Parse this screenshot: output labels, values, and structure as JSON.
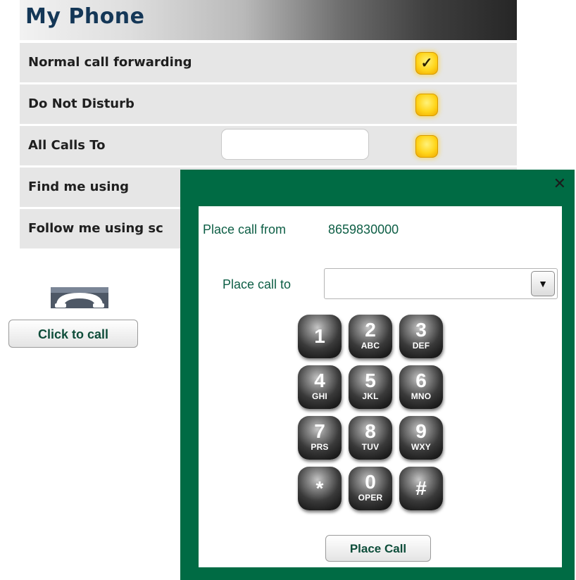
{
  "header": {
    "title": "My Phone"
  },
  "rows": [
    {
      "label": "Normal call forwarding",
      "checked": true
    },
    {
      "label": "Do Not Disturb",
      "checked": false
    },
    {
      "label": "All Calls To",
      "checked": false,
      "input_value": ""
    },
    {
      "label": "Find me using"
    },
    {
      "label": "Follow me using sc"
    }
  ],
  "checkmark": "✓",
  "phone": {
    "icon": "phone-handset-icon",
    "click_to_call_label": "Click to call"
  },
  "dialog": {
    "close_label": "✕",
    "place_call_from_label": "Place call from",
    "place_call_from_value": "8659830000",
    "place_call_to_label": "Place call to",
    "place_call_to_value": "",
    "dropdown_arrow": "▼",
    "keypad": [
      {
        "digit": "1",
        "letters": ""
      },
      {
        "digit": "2",
        "letters": "ABC"
      },
      {
        "digit": "3",
        "letters": "DEF"
      },
      {
        "digit": "4",
        "letters": "GHI"
      },
      {
        "digit": "5",
        "letters": "JKL"
      },
      {
        "digit": "6",
        "letters": "MNO"
      },
      {
        "digit": "7",
        "letters": "PRS"
      },
      {
        "digit": "8",
        "letters": "TUV"
      },
      {
        "digit": "9",
        "letters": "WXY"
      },
      {
        "digit": "*",
        "letters": ""
      },
      {
        "digit": "0",
        "letters": "OPER"
      },
      {
        "digit": "#",
        "letters": ""
      }
    ],
    "place_call_button": "Place Call"
  },
  "colors": {
    "accent_green": "#006b44",
    "title_navy": "#143757",
    "check_yellow": "#ffd51a"
  }
}
